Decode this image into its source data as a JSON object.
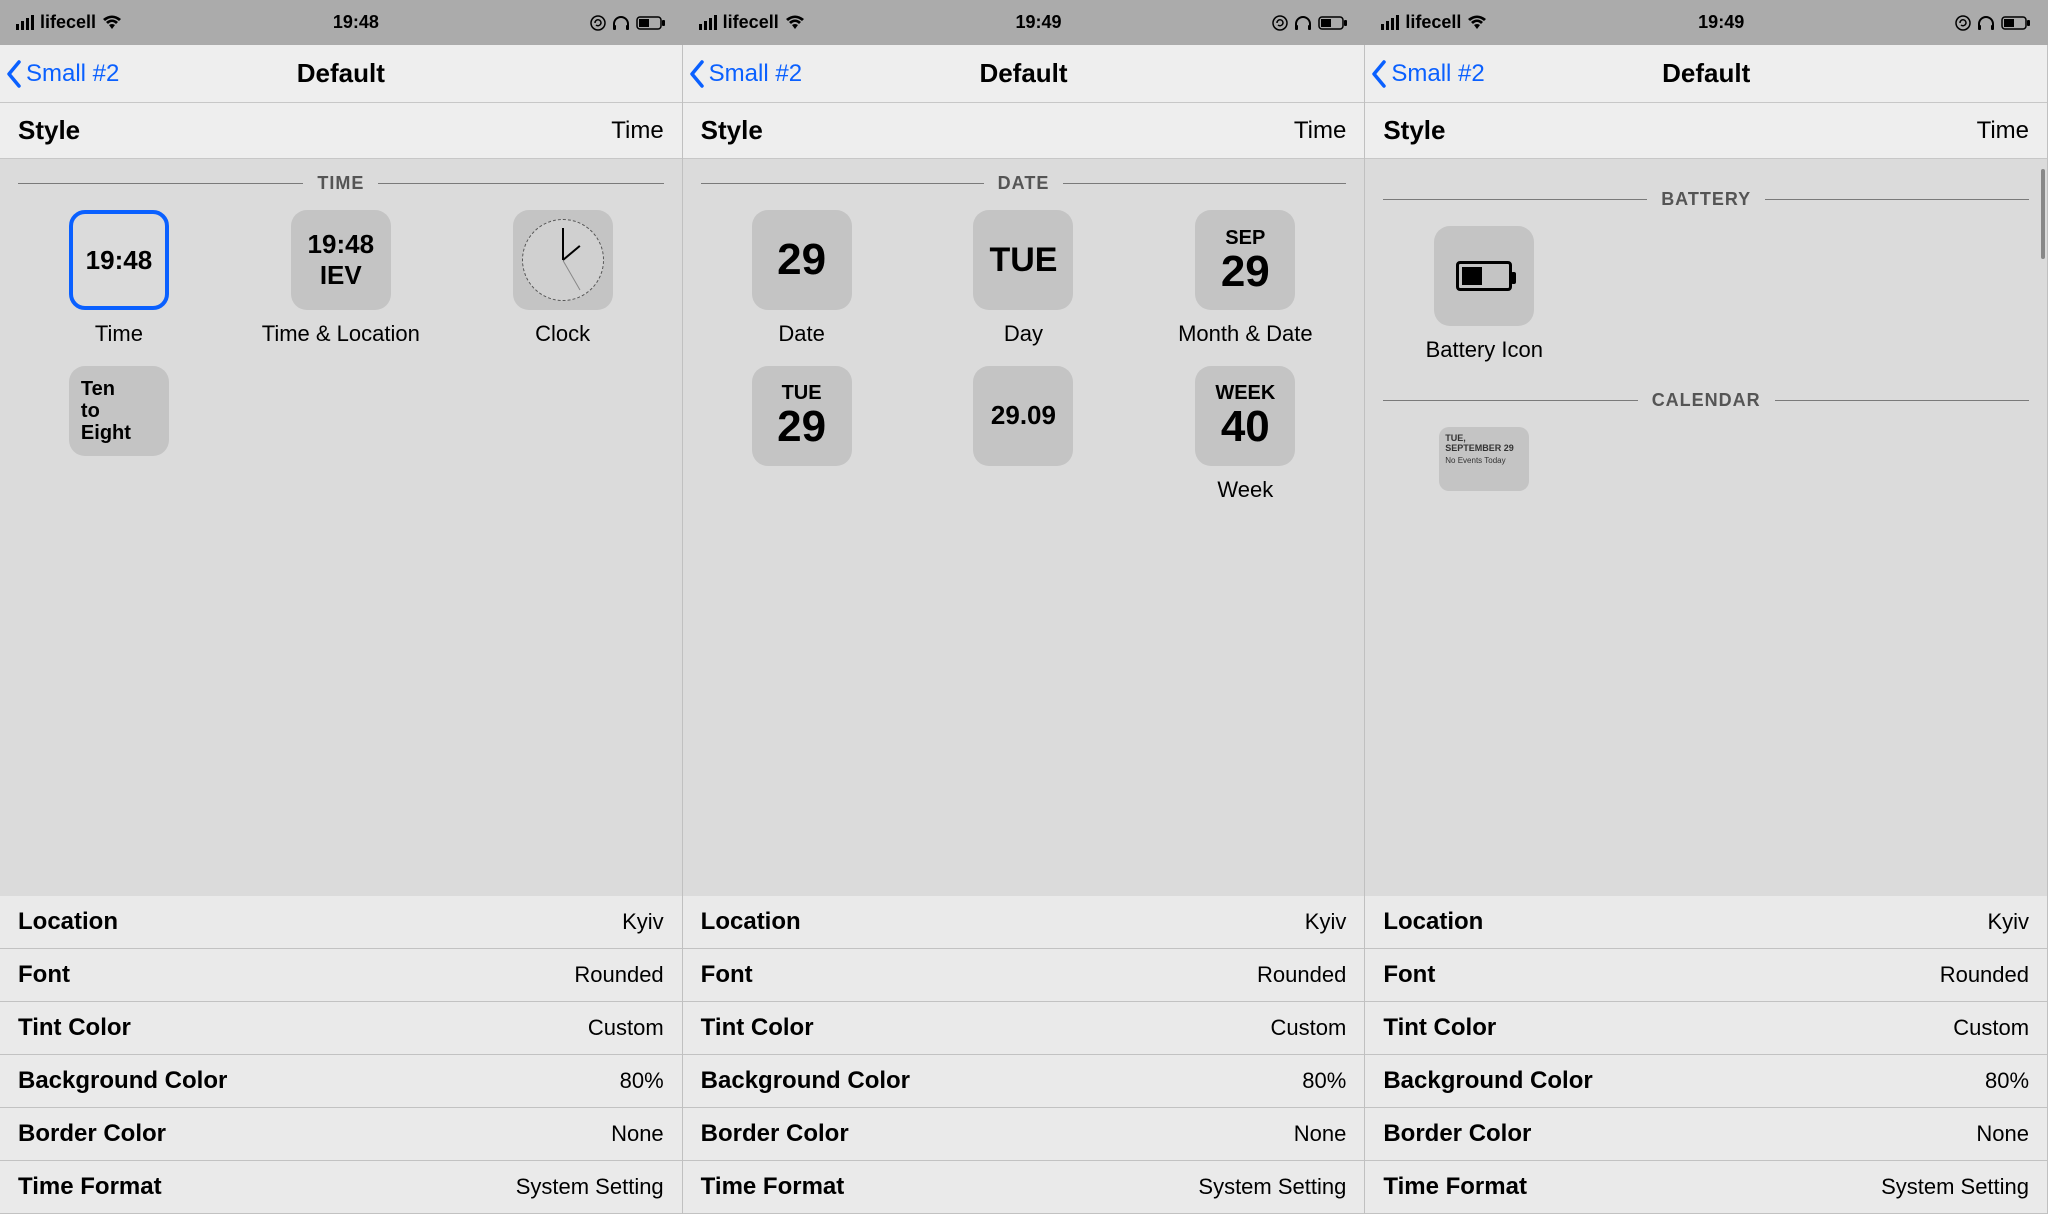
{
  "panels": [
    {
      "status": {
        "carrier": "lifecell",
        "time": "19:48"
      },
      "nav": {
        "back": "Small #2",
        "title": "Default"
      },
      "style": {
        "label": "Style",
        "value": "Time"
      },
      "section1": {
        "header": "TIME"
      },
      "tiles": {
        "time": {
          "text": "19:48",
          "cap": "Time"
        },
        "timeloc": {
          "l1": "19:48",
          "l2": "IEV",
          "cap": "Time & Location"
        },
        "clock": {
          "cap": "Clock"
        },
        "fuzzy": {
          "l1": "Ten",
          "l2": "to",
          "l3": "Eight"
        }
      },
      "settings": [
        {
          "label": "Location",
          "value": "Kyiv"
        },
        {
          "label": "Font",
          "value": "Rounded"
        },
        {
          "label": "Tint Color",
          "value": "Custom"
        },
        {
          "label": "Background Color",
          "value": "80%"
        },
        {
          "label": "Border Color",
          "value": "None"
        },
        {
          "label": "Time Format",
          "value": "System Setting"
        }
      ]
    },
    {
      "status": {
        "carrier": "lifecell",
        "time": "19:49"
      },
      "nav": {
        "back": "Small #2",
        "title": "Default"
      },
      "style": {
        "label": "Style",
        "value": "Time"
      },
      "section1": {
        "header": "DATE"
      },
      "tiles": {
        "date": {
          "text": "29",
          "cap": "Date"
        },
        "day": {
          "text": "TUE",
          "cap": "Day"
        },
        "monthdate": {
          "l1": "SEP",
          "l2": "29",
          "cap": "Month & Date"
        },
        "daydate": {
          "l1": "TUE",
          "l2": "29"
        },
        "mmdd": {
          "text": "29.09"
        },
        "week": {
          "l1": "WEEK",
          "l2": "40",
          "cap": "Week"
        }
      },
      "settings": [
        {
          "label": "Location",
          "value": "Kyiv"
        },
        {
          "label": "Font",
          "value": "Rounded"
        },
        {
          "label": "Tint Color",
          "value": "Custom"
        },
        {
          "label": "Background Color",
          "value": "80%"
        },
        {
          "label": "Border Color",
          "value": "None"
        },
        {
          "label": "Time Format",
          "value": "System Setting"
        }
      ]
    },
    {
      "status": {
        "carrier": "lifecell",
        "time": "19:49"
      },
      "nav": {
        "back": "Small #2",
        "title": "Default"
      },
      "style": {
        "label": "Style",
        "value": "Time"
      },
      "section1": {
        "header": "BATTERY"
      },
      "section2": {
        "header": "CALENDAR"
      },
      "tiles": {
        "battery": {
          "cap": "Battery Icon"
        },
        "cal": {
          "l1": "TUE, SEPTEMBER 29",
          "l2": "No Events Today"
        }
      },
      "settings": [
        {
          "label": "Location",
          "value": "Kyiv"
        },
        {
          "label": "Font",
          "value": "Rounded"
        },
        {
          "label": "Tint Color",
          "value": "Custom"
        },
        {
          "label": "Background Color",
          "value": "80%"
        },
        {
          "label": "Border Color",
          "value": "None"
        },
        {
          "label": "Time Format",
          "value": "System Setting"
        }
      ]
    }
  ]
}
